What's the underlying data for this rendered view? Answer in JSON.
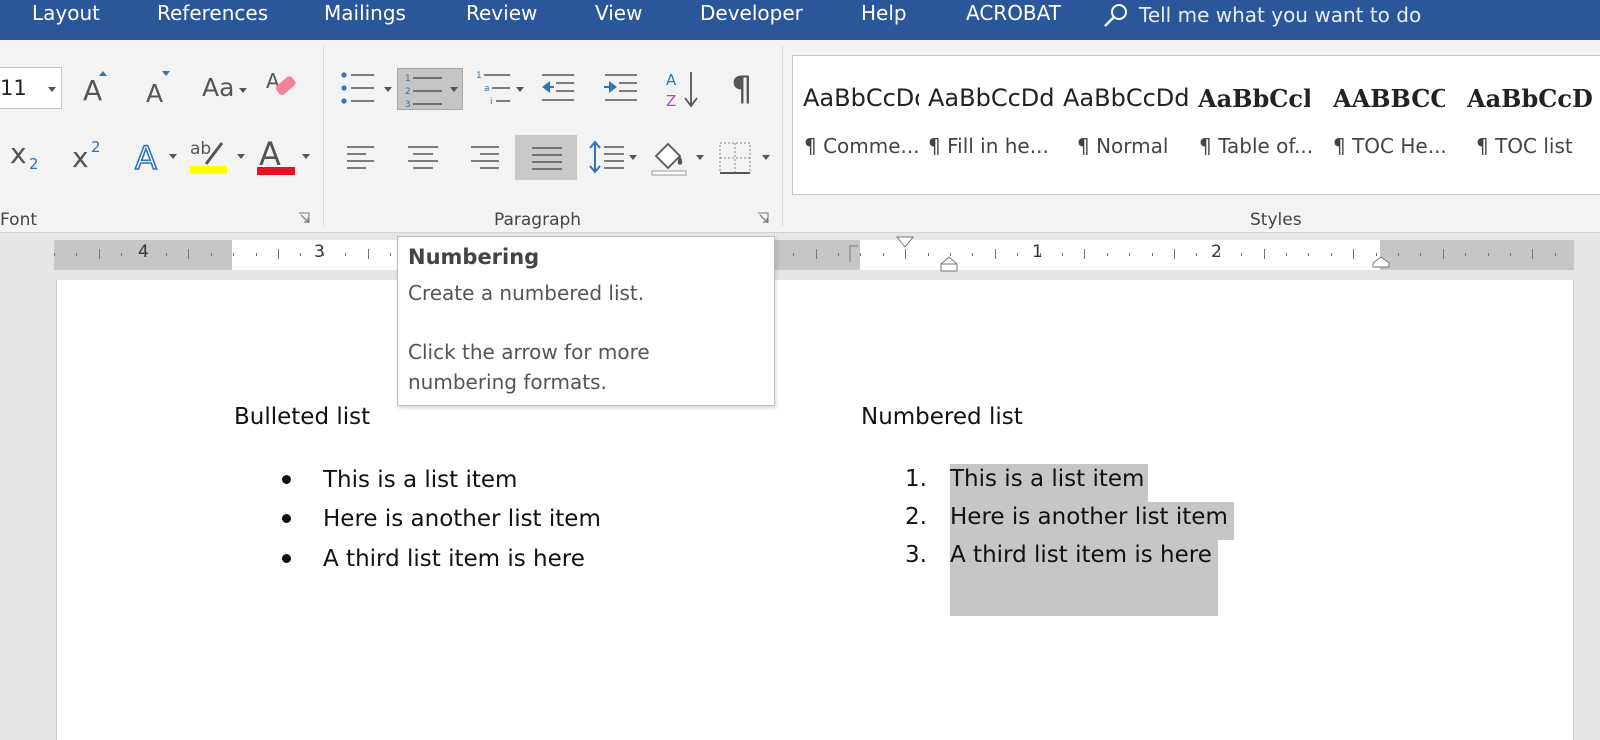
{
  "tabs": [
    "Layout",
    "References",
    "Mailings",
    "Review",
    "View",
    "Developer",
    "Help",
    "ACROBAT"
  ],
  "tell_me": "Tell me what you want to do",
  "font_group": {
    "font_size": "11",
    "change_case_label": "Aa",
    "label": "Font"
  },
  "paragraph_group": {
    "label": "Paragraph"
  },
  "styles_group": {
    "label": "Styles",
    "items": [
      {
        "preview": "AaBbCcDd",
        "name": "¶ Comme..."
      },
      {
        "preview": "AaBbCcDd",
        "name": "¶ Fill in he..."
      },
      {
        "preview": "AaBbCcDd",
        "name": "¶ Normal"
      },
      {
        "preview": "AaBbCcl",
        "name": "¶ Table of..."
      },
      {
        "preview": "AABBCC",
        "name": "¶ TOC He..."
      },
      {
        "preview": "AaBbCcD",
        "name": "¶ TOC list"
      }
    ]
  },
  "ruler": {
    "numbers": [
      "4",
      "3",
      "1",
      "2"
    ]
  },
  "tooltip": {
    "title": "Numbering",
    "line1": "Create a numbered list.",
    "line2": "Click the arrow for more",
    "line3": "numbering formats."
  },
  "document": {
    "bulleted_heading": "Bulleted list",
    "bulleted_items": [
      "This is a list item",
      "Here is another list item",
      "A third list item is here"
    ],
    "numbered_heading": "Numbered list",
    "numbered_markers": [
      "1.",
      "2.",
      "3."
    ],
    "numbered_items": [
      "This is a list item",
      "Here is another list item",
      "A third list item is here"
    ]
  },
  "colors": {
    "tab_bar": "#2b579a",
    "highlight_yellow": "#ffff00",
    "font_color_red": "#e81123",
    "accent_blue": "#2e75b6"
  }
}
